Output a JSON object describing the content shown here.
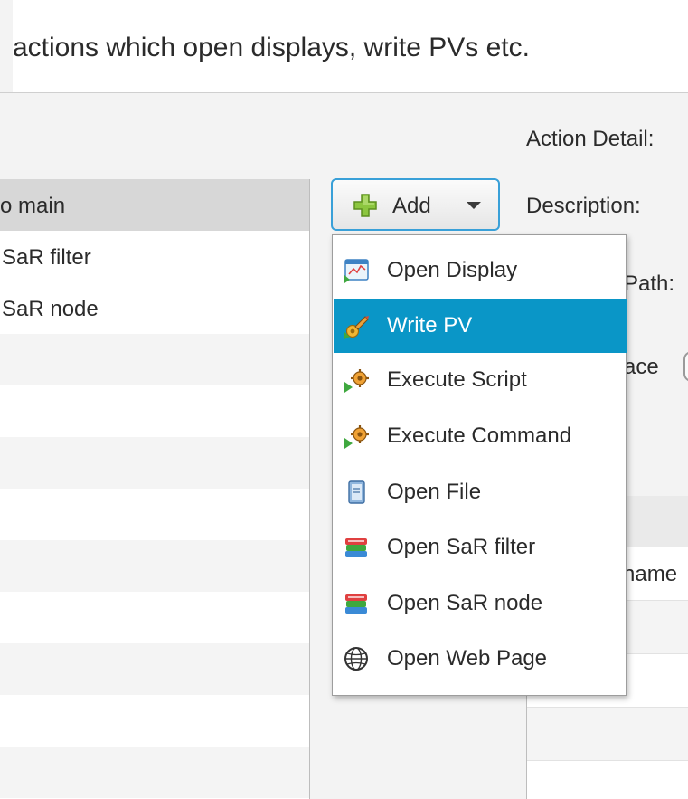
{
  "header": {
    "description": "actions which open displays, write PVs etc."
  },
  "left_list": {
    "items": [
      {
        "label": "main",
        "prefix": "o",
        "selected": true
      },
      {
        "label": "aR filter",
        "prefix": "S"
      },
      {
        "label": "aR node",
        "prefix": "S"
      }
    ]
  },
  "details": {
    "action_detail_label": "Action Detail:",
    "description_label": "Description:",
    "path_label_partial": "Path:",
    "replace_label_partial": "ace",
    "table_cell_partial": "name"
  },
  "add_button": {
    "label": "Add"
  },
  "menu": {
    "items": [
      {
        "label": "Open Display",
        "icon": "display-icon"
      },
      {
        "label": "Write PV",
        "icon": "pencil-pv-icon",
        "highlighted": true
      },
      {
        "label": "Execute Script",
        "icon": "gear-run-icon"
      },
      {
        "label": "Execute Command",
        "icon": "gear-run-icon"
      },
      {
        "label": "Open File",
        "icon": "file-icon"
      },
      {
        "label": "Open SaR filter",
        "icon": "books-icon"
      },
      {
        "label": "Open SaR node",
        "icon": "books-icon"
      },
      {
        "label": "Open Web Page",
        "icon": "globe-icon"
      }
    ]
  },
  "colors": {
    "highlight": "#0a96c7",
    "button_border": "#39a0d8",
    "selection": "#d7d7d7"
  }
}
